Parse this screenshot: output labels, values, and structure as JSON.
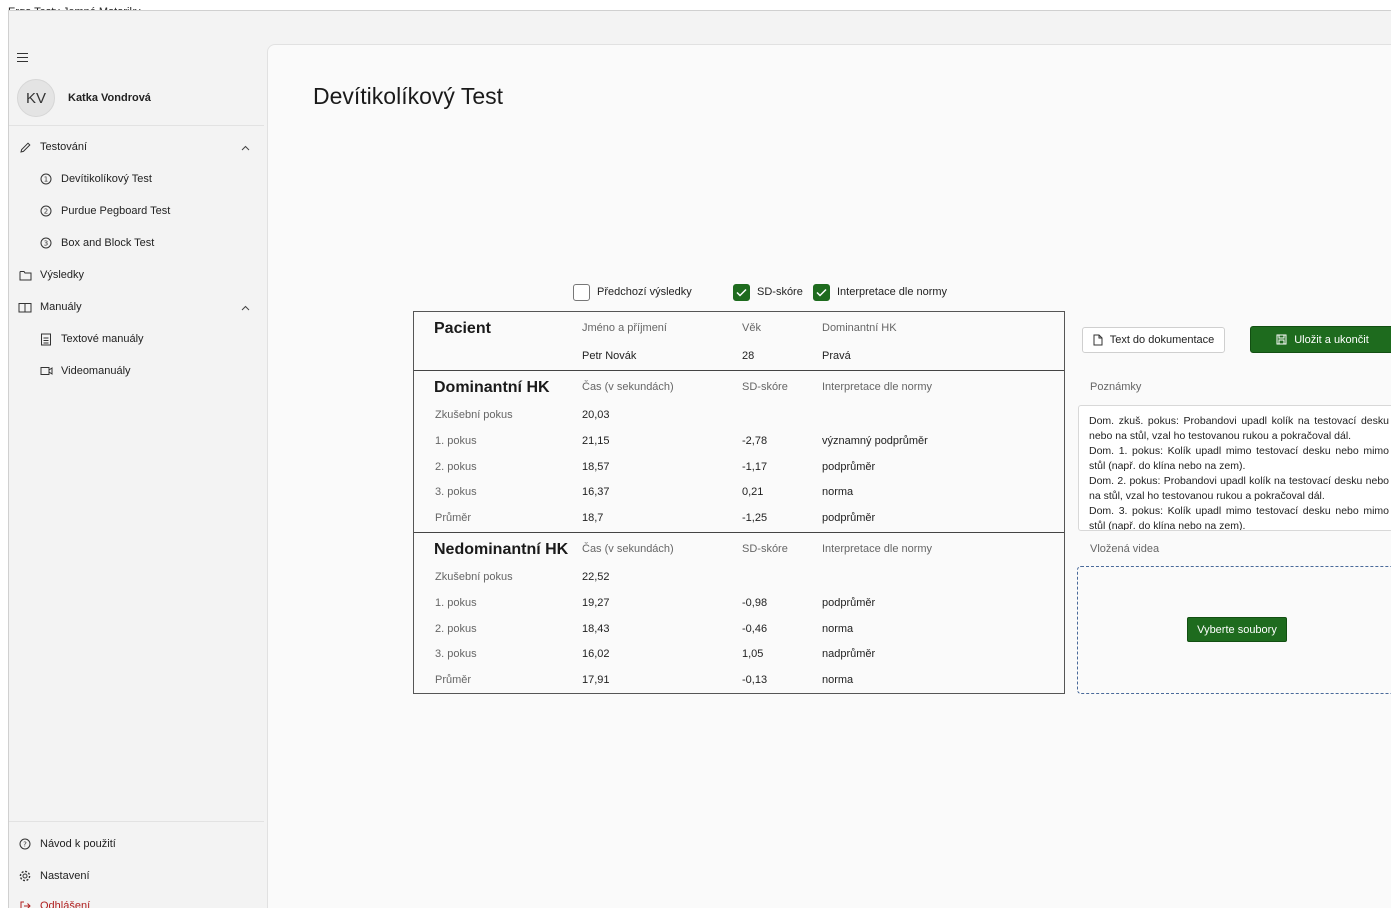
{
  "app": {
    "title": "Ergo Testy Jemné Motoriky"
  },
  "user": {
    "initials": "KV",
    "name": "Katka Vondrová"
  },
  "sidebar": {
    "testing": "Testování",
    "tests": [
      "Devítikolíkový Test",
      "Purdue Pegboard Test",
      "Box and Block Test"
    ],
    "results": "Výsledky",
    "manuals": "Manuály",
    "manual_items": [
      "Textové manuály",
      "Videomanuály"
    ],
    "help": "Návod k použití",
    "settings": "Nastavení",
    "logout": "Odhlášení"
  },
  "page": {
    "title": "Devítikolíkový Test"
  },
  "options": {
    "previous_results": {
      "label": "Předchozí výsledky",
      "checked": false
    },
    "sd_score": {
      "label": "SD-skóre",
      "checked": true
    },
    "norm_interpretation": {
      "label": "Interpretace dle normy",
      "checked": true
    }
  },
  "patient": {
    "section": "Pacient",
    "headers": [
      "Jméno a příjmení",
      "Věk",
      "Dominantní HK"
    ],
    "name": "Petr Novák",
    "age": "28",
    "dominant_hand": "Pravá"
  },
  "dominant": {
    "section": "Dominantní HK",
    "headers": [
      "Čas (v sekundách)",
      "SD-skóre",
      "Interpretace dle normy"
    ],
    "rows": [
      {
        "label": "Zkušební pokus",
        "time": "20,03",
        "sd": "",
        "interp": ""
      },
      {
        "label": "1. pokus",
        "time": "21,15",
        "sd": "-2,78",
        "interp": "významný podprůměr"
      },
      {
        "label": "2. pokus",
        "time": "18,57",
        "sd": "-1,17",
        "interp": "podprůměr"
      },
      {
        "label": "3. pokus",
        "time": "16,37",
        "sd": "0,21",
        "interp": "norma"
      },
      {
        "label": "Průměr",
        "time": "18,7",
        "sd": "-1,25",
        "interp": "podprůměr"
      }
    ]
  },
  "nondominant": {
    "section": "Nedominantní HK",
    "headers": [
      "Čas (v sekundách)",
      "SD-skóre",
      "Interpretace dle normy"
    ],
    "rows": [
      {
        "label": "Zkušební pokus",
        "time": "22,52",
        "sd": "",
        "interp": ""
      },
      {
        "label": "1. pokus",
        "time": "19,27",
        "sd": "-0,98",
        "interp": "podprůměr"
      },
      {
        "label": "2. pokus",
        "time": "18,43",
        "sd": "-0,46",
        "interp": "norma"
      },
      {
        "label": "3. pokus",
        "time": "16,02",
        "sd": "1,05",
        "interp": "nadprůměr"
      },
      {
        "label": "Průměr",
        "time": "17,91",
        "sd": "-0,13",
        "interp": "norma"
      }
    ]
  },
  "actions": {
    "export_text": "Text do dokumentace",
    "save_exit": "Uložit a ukončit"
  },
  "notes": {
    "label": "Poznámky",
    "lines": [
      "Dom. zkuš. pokus: Probandovi upadl kolík na testovací desku nebo na stůl, vzal ho testovanou rukou a pokračoval dál.",
      "Dom. 1. pokus: Kolík upadl mimo testovací desku nebo mimo stůl (např. do klína nebo na zem).",
      "Dom. 2. pokus: Probandovi upadl kolík na testovací desku nebo na stůl, vzal ho testovanou rukou a pokračoval dál.",
      "Dom. 3. pokus: Kolík upadl mimo testovací desku nebo mimo stůl (např. do klína nebo na zem)."
    ]
  },
  "videos": {
    "label": "Vložená videa",
    "choose_files": "Vyberte soubory"
  }
}
